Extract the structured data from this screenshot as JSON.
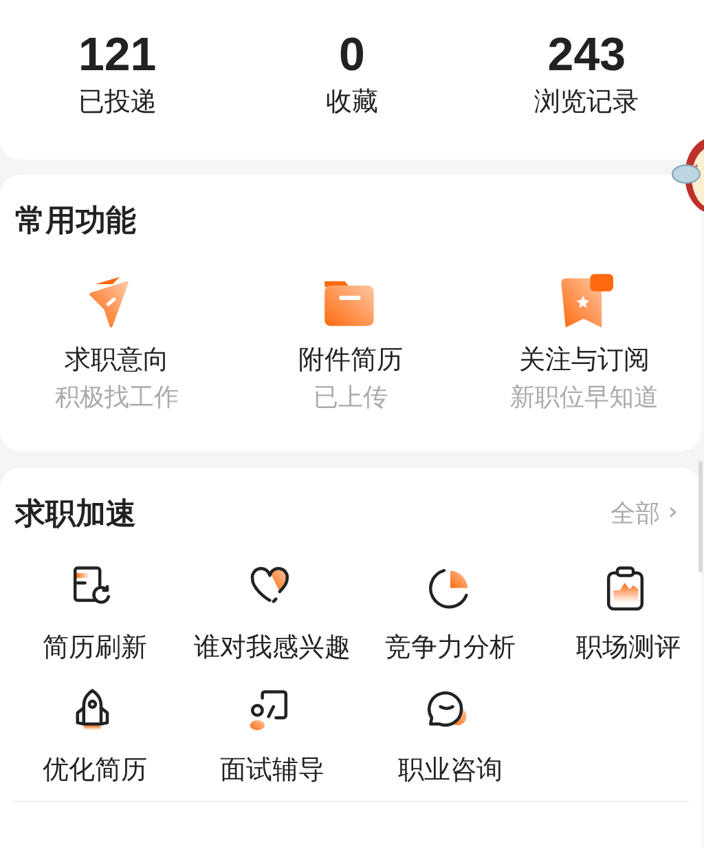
{
  "stats": [
    {
      "value": "121",
      "label": "已投递"
    },
    {
      "value": "0",
      "label": "收藏"
    },
    {
      "value": "243",
      "label": "浏览记录"
    }
  ],
  "common_functions": {
    "title": "常用功能",
    "items": [
      {
        "title": "求职意向",
        "subtitle": "积极找工作"
      },
      {
        "title": "附件简历",
        "subtitle": "已上传"
      },
      {
        "title": "关注与订阅",
        "subtitle": "新职位早知道"
      }
    ]
  },
  "job_boost": {
    "title": "求职加速",
    "more": "全部",
    "more_arrow": "›",
    "items": [
      {
        "label": "简历刷新"
      },
      {
        "label": "谁对我感兴趣"
      },
      {
        "label": "竞争力分析"
      },
      {
        "label": "职场测评"
      },
      {
        "label": "优化简历"
      },
      {
        "label": "面试辅导"
      },
      {
        "label": "职业咨询"
      }
    ]
  }
}
